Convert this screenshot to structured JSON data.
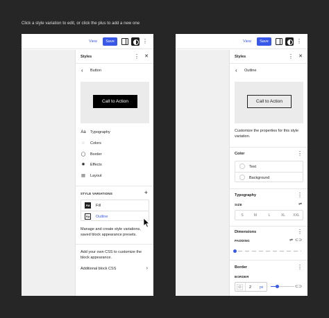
{
  "caption": "Click a style variation to edit, or click the plus to add a new one",
  "colors": {
    "accent": "#3858e9",
    "background": "#262626",
    "canvas": "#f0f0f0"
  },
  "left": {
    "topbar": {
      "view_label": "View",
      "save_label": "Save"
    },
    "sidebar": {
      "title": "Styles",
      "nav_title": "Button",
      "preview_button": "Call to Action",
      "menu": [
        {
          "label": "Typography",
          "icon": "typography-icon",
          "glyph": "Aa"
        },
        {
          "label": "Colors",
          "icon": "droplet-icon",
          "glyph": "◌"
        },
        {
          "label": "Border",
          "icon": "border-icon",
          "glyph": "◯"
        },
        {
          "label": "Effects",
          "icon": "effects-icon",
          "glyph": "✺"
        },
        {
          "label": "Layout",
          "icon": "layout-icon",
          "glyph": "▤"
        }
      ],
      "style_variations_heading": "STYLE VARIATIONS",
      "variations": [
        {
          "label": "Fill",
          "glyph": "Aa"
        },
        {
          "label": "Outline",
          "glyph": "Aa"
        }
      ],
      "variations_help": "Manage and create style variations, saved block appearance presets.",
      "css_help": "Add your own CSS to customize the block appearance.",
      "additional_css": "Additional block CSS"
    }
  },
  "right": {
    "topbar": {
      "view_label": "View",
      "save_label": "Save"
    },
    "sidebar": {
      "title": "Styles",
      "nav_title": "Outline",
      "preview_button": "Call to Action",
      "description": "Customize the properties for this style variation.",
      "color_section": {
        "title": "Color",
        "items": [
          "Text",
          "Background"
        ]
      },
      "typography_section": {
        "title": "Typography",
        "size_label": "SIZE",
        "sizes": [
          "S",
          "M",
          "L",
          "XL",
          "XXL"
        ]
      },
      "dimensions_section": {
        "title": "Dimensions",
        "padding_label": "PADDING"
      },
      "border_section": {
        "title": "Border",
        "border_label": "BORDER",
        "width_value": "2",
        "width_unit": "px"
      }
    }
  }
}
